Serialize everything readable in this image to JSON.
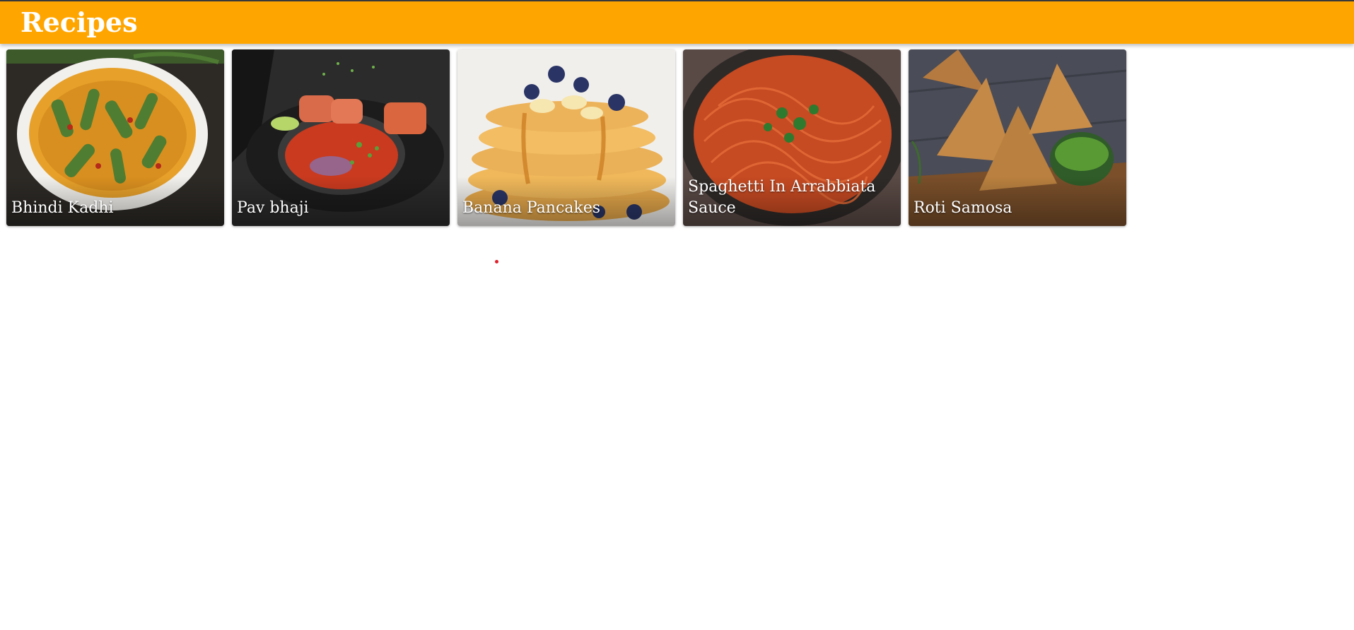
{
  "header": {
    "title": "Recipes",
    "accent_color": "#ffa500"
  },
  "recipes": [
    {
      "name": "Bhindi Kadhi",
      "image_icon": "bhindi-kadhi-photo"
    },
    {
      "name": "Pav bhaji",
      "image_icon": "pav-bhaji-photo"
    },
    {
      "name": "Banana Pancakes",
      "image_icon": "banana-pancakes-photo"
    },
    {
      "name": "Spaghetti In Arrabbiata Sauce",
      "image_icon": "spaghetti-photo"
    },
    {
      "name": "Roti Samosa",
      "image_icon": "roti-samosa-photo"
    }
  ],
  "loading_indicator": {
    "color": "#e0202a",
    "icon": "loading-dot-icon"
  }
}
